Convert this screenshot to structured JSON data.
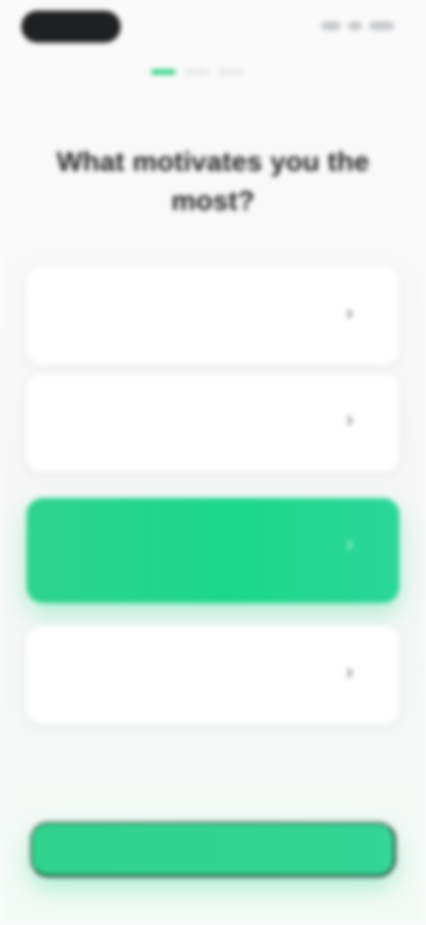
{
  "status_bar": {
    "time": "",
    "indicators": ""
  },
  "progress": {
    "steps": 3,
    "current": 1
  },
  "title": "What motivates you the most?",
  "options": [
    {
      "label": "",
      "description": ""
    },
    {
      "label": "",
      "description": ""
    },
    {
      "label": "",
      "description": ""
    },
    {
      "label": "",
      "description": ""
    }
  ],
  "selected_option": 2,
  "continue_button": {
    "label": ""
  },
  "colors": {
    "accent": "#22d58a",
    "background": "#f8f8f9",
    "card": "#ffffff"
  },
  "icons": {
    "option_chevron": "chevron-right-icon"
  }
}
